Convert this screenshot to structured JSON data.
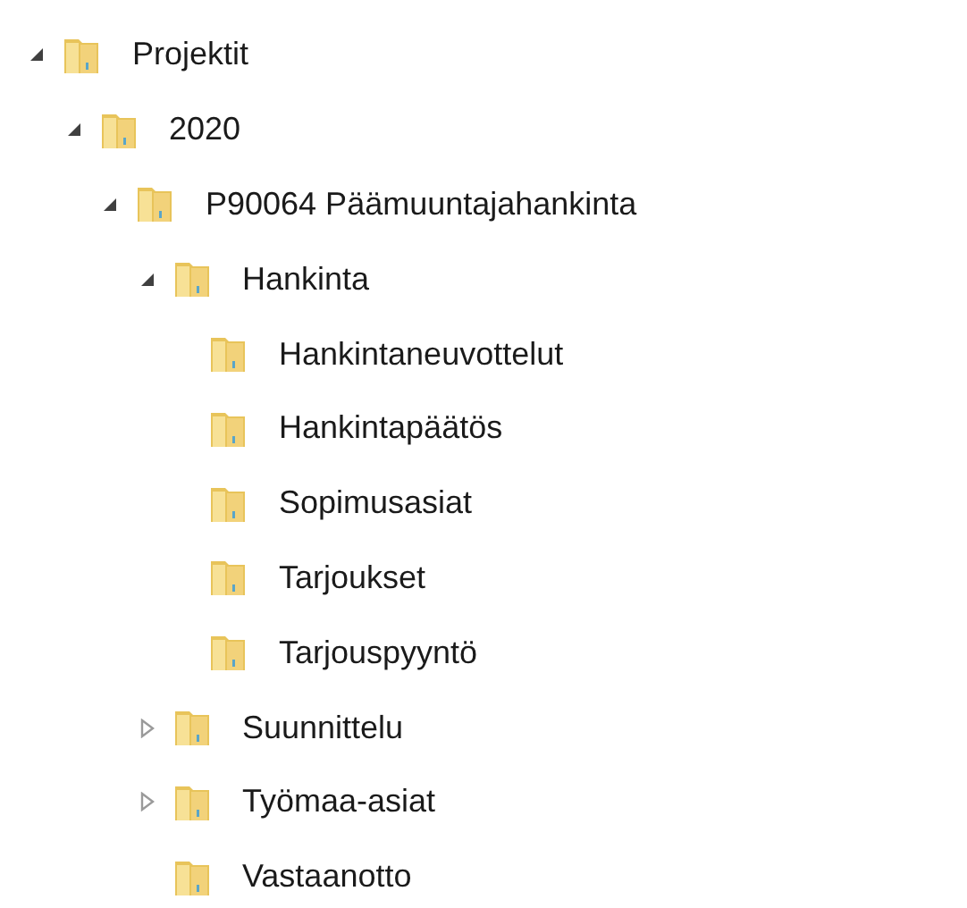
{
  "tree": [
    {
      "label": "Projektit",
      "expanded": true,
      "children": [
        {
          "label": "2020",
          "expanded": true,
          "children": [
            {
              "label": "P90064 Päämuuntajahankinta",
              "expanded": true,
              "children": [
                {
                  "label": "Hankinta",
                  "expanded": true,
                  "children": [
                    {
                      "label": "Hankintaneuvottelut"
                    },
                    {
                      "label": "Hankintapäätös"
                    },
                    {
                      "label": "Sopimusasiat"
                    },
                    {
                      "label": "Tarjoukset"
                    },
                    {
                      "label": "Tarjouspyyntö"
                    }
                  ]
                },
                {
                  "label": "Suunnittelu",
                  "expanded": false
                },
                {
                  "label": "Työmaa-asiat",
                  "expanded": false
                },
                {
                  "label": "Vastaanotto"
                }
              ]
            }
          ]
        }
      ]
    }
  ]
}
